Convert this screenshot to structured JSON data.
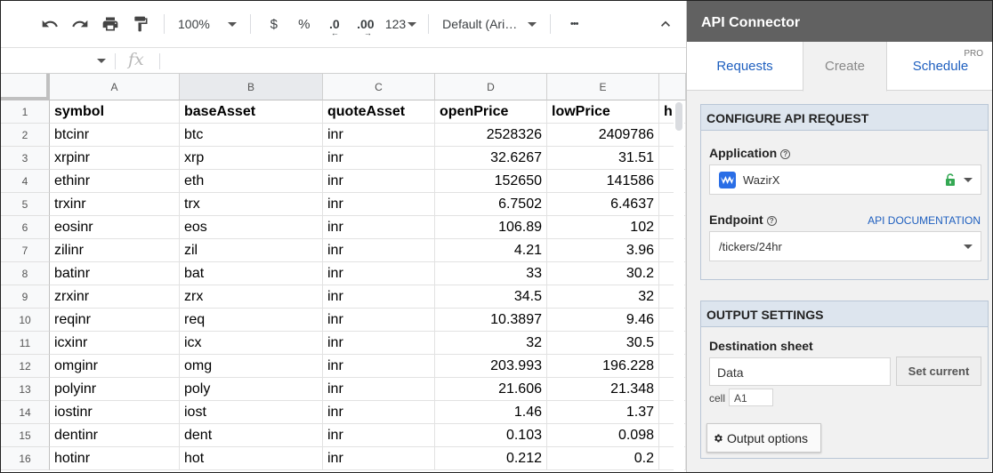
{
  "toolbar": {
    "zoom": "100%",
    "currency": "$",
    "percent": "%",
    "decrease_decimal": ".0",
    "increase_decimal": ".00",
    "number_format": "123",
    "font": "Default (Ari…",
    "more": "•••"
  },
  "formula_bar": {
    "fx": "fx"
  },
  "sheet": {
    "columns": [
      "A",
      "B",
      "C",
      "D",
      "E"
    ],
    "selected_column": "B",
    "rows": [
      {
        "n": "1",
        "cells": [
          "symbol",
          "baseAsset",
          "quoteAsset",
          "openPrice",
          "lowPrice",
          "h"
        ]
      },
      {
        "n": "2",
        "cells": [
          "btcinr",
          "btc",
          "inr",
          "2528326",
          "2409786",
          ""
        ]
      },
      {
        "n": "3",
        "cells": [
          "xrpinr",
          "xrp",
          "inr",
          "32.6267",
          "31.51",
          ""
        ]
      },
      {
        "n": "4",
        "cells": [
          "ethinr",
          "eth",
          "inr",
          "152650",
          "141586",
          ""
        ]
      },
      {
        "n": "5",
        "cells": [
          "trxinr",
          "trx",
          "inr",
          "6.7502",
          "6.4637",
          ""
        ]
      },
      {
        "n": "6",
        "cells": [
          "eosinr",
          "eos",
          "inr",
          "106.89",
          "102",
          ""
        ]
      },
      {
        "n": "7",
        "cells": [
          "zilinr",
          "zil",
          "inr",
          "4.21",
          "3.96",
          ""
        ]
      },
      {
        "n": "8",
        "cells": [
          "batinr",
          "bat",
          "inr",
          "33",
          "30.2",
          ""
        ]
      },
      {
        "n": "9",
        "cells": [
          "zrxinr",
          "zrx",
          "inr",
          "34.5",
          "32",
          ""
        ]
      },
      {
        "n": "10",
        "cells": [
          "reqinr",
          "req",
          "inr",
          "10.3897",
          "9.46",
          ""
        ]
      },
      {
        "n": "11",
        "cells": [
          "icxinr",
          "icx",
          "inr",
          "32",
          "30.5",
          ""
        ]
      },
      {
        "n": "12",
        "cells": [
          "omginr",
          "omg",
          "inr",
          "203.993",
          "196.228",
          ""
        ]
      },
      {
        "n": "13",
        "cells": [
          "polyinr",
          "poly",
          "inr",
          "21.606",
          "21.348",
          ""
        ]
      },
      {
        "n": "14",
        "cells": [
          "iostinr",
          "iost",
          "inr",
          "1.46",
          "1.37",
          ""
        ]
      },
      {
        "n": "15",
        "cells": [
          "dentinr",
          "dent",
          "inr",
          "0.103",
          "0.098",
          ""
        ]
      },
      {
        "n": "16",
        "cells": [
          "hotinr",
          "hot",
          "inr",
          "0.212",
          "0.2",
          ""
        ]
      }
    ]
  },
  "sidebar": {
    "title": "API Connector",
    "tabs": {
      "requests": "Requests",
      "create": "Create",
      "schedule": "Schedule",
      "pro": "PRO"
    },
    "configure": {
      "heading": "CONFIGURE API REQUEST",
      "application_label": "Application",
      "application_value": "WazirX",
      "endpoint_label": "Endpoint",
      "api_doc_link": "API DOCUMENTATION",
      "endpoint_value": "/tickers/24hr"
    },
    "output": {
      "heading": "OUTPUT SETTINGS",
      "destination_label": "Destination sheet",
      "destination_value": "Data",
      "set_current": "Set current",
      "cell_label": "cell",
      "cell_value": "A1",
      "output_options": "Output options"
    }
  },
  "colors": {
    "sidebar_title_bg": "#616161",
    "link_blue": "#1e5fbf",
    "panel_head_bg": "#dde5ee",
    "lock_green": "#34a853",
    "wazirx_blue": "#2a6ee6"
  }
}
